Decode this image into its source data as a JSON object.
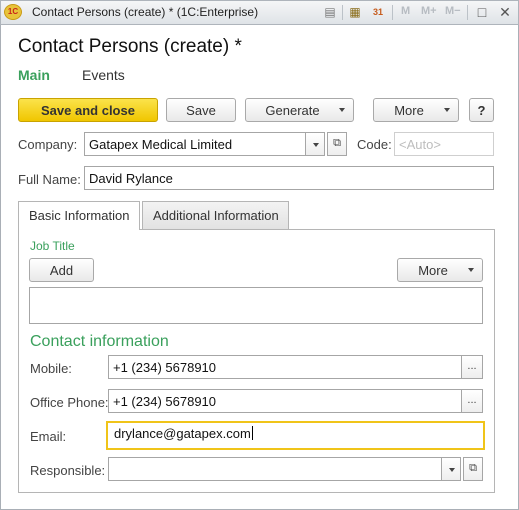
{
  "window": {
    "title": "Contact Persons (create) * (1C:Enterprise)",
    "logo_text": "1C",
    "memory_buttons": [
      "M",
      "M+",
      "M−"
    ]
  },
  "form": {
    "title": "Contact Persons (create) *",
    "sections": {
      "main": "Main",
      "events": "Events"
    }
  },
  "toolbar": {
    "save_close": "Save and close",
    "save": "Save",
    "generate": "Generate",
    "more": "More",
    "help": "?"
  },
  "fields": {
    "company_label": "Company:",
    "company_value": "Gatapex Medical Limited",
    "code_label": "Code:",
    "code_placeholder": "<Auto>",
    "full_name_label": "Full Name:",
    "full_name_value": "David Rylance"
  },
  "tabs": {
    "basic": "Basic Information",
    "additional": "Additional Information"
  },
  "basic": {
    "job_title_label": "Job Title",
    "add_button": "Add",
    "more_button": "More",
    "contact_header": "Contact information",
    "mobile_label": "Mobile:",
    "mobile_value": "+1 (234) 5678910",
    "office_phone_label": "Office Phone:",
    "office_phone_value": "+1 (234) 5678910",
    "email_label": "Email:",
    "email_value": "drylance@gatapex.com",
    "responsible_label": "Responsible:",
    "responsible_value": "",
    "ellipsis": "..."
  },
  "colors": {
    "accent_green": "#3aa05c",
    "primary_button": "#f0c600",
    "focus_border": "#f0c419"
  }
}
